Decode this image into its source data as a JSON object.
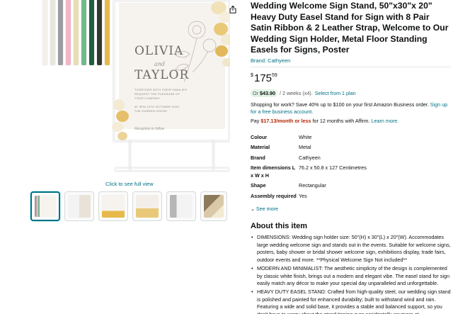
{
  "gallery": {
    "see_full_view": "Click to see full view",
    "thumbnail_count": 6,
    "sign": {
      "name1": "OLIVIA",
      "and": "and",
      "name2": "TAYLOR",
      "line1": "TOGETHER WITH THEIR FAMILIES",
      "line2": "REQUEST THE PLEASURE OF",
      "line3": "YOUR COMPANY",
      "date": "AT 5PM 10TH OCTOBER 2025",
      "venue": "THE GARDEN HOUSE",
      "signature": "Reception to follow"
    }
  },
  "product": {
    "title": "Wedding Welcome Sign Stand, 50\"x30\"x 20\" Heavy Duty Easel Stand for Sign with 8 Pair Satin Ribbon & 2 Leather Strap, Welcome to Our Wedding Sign Holder, Metal Floor Standing Easels for Signs, Poster",
    "brand_link": "Brand: Cathyeen",
    "price": {
      "symbol": "$",
      "whole": "175",
      "fraction": "59"
    },
    "plan": {
      "or": "Or",
      "amount": "$43.90",
      "term": "/ 2 weeks (x4).",
      "link": "Select from 1 plan"
    },
    "business_offer": {
      "text": "Shopping for work? Save 40% up to $100 on your first Amazon Business order.",
      "link": "Sign up for a free business account."
    },
    "affirm": {
      "prefix": "Pay",
      "amount": "$17.13/month or less",
      "middle": "for 12 months",
      "suffix": "with Affirm.",
      "link": "Learn more."
    },
    "specs": [
      {
        "label": "Colour",
        "value": "White"
      },
      {
        "label": "Material",
        "value": "Metal"
      },
      {
        "label": "Brand",
        "value": "Cathyeen"
      },
      {
        "label": "Item dimensions L x W x H",
        "value": "76.2 x 50.8 x 127 Centimetres"
      },
      {
        "label": "Shape",
        "value": "Rectangular"
      },
      {
        "label": "Assembly required",
        "value": "Yes"
      }
    ],
    "see_more": "See more",
    "about_title": "About this item",
    "bullets": [
      "DIMENSIONS: Wedding sign holder size: 50\"(H) x 30\"(L) x 20\"(W). Accommodates large wedding welcome sign and stands out in the events. Suitable for welcome signs, posters, baby shower or bridal shower welcome sign, exhibitions display, trade fairs, outdoor events and more. **Physical Welcome Sign Not included**",
      "MODERN AND MINIMALIST: The aesthetic simplicity of the design is complemented by classic white finish, brings out a modern and elegant vibe. The easel stand for sign easily match any décor to make your special day unparalleled and unforgettable.",
      "HEAVY DUTY EASEL STAND: Crafted from high-quality steel, our wedding sign stand is polished and painted for enhanced durability; built to withstand wind and rain. Featuring a wide and solid base, it provides a stable and balanced support, so you don't have to worry about the stand tipping over accidentally anymore at"
    ]
  },
  "colors": {
    "link": "#007185",
    "price_red": "#b12704",
    "plan_green_bg": "#e3f3e6",
    "text": "#0f1111",
    "ribbons": [
      "#f2f0ea",
      "#e9e6dd",
      "#9a9da0",
      "#f0b6c4",
      "#e9ddb8",
      "#6fb98c",
      "#1f5e3f",
      "#2f3b31",
      "#e6b94a"
    ]
  },
  "icons": {
    "share": "share-icon",
    "see_more_chevron": "chevron-down-icon"
  }
}
